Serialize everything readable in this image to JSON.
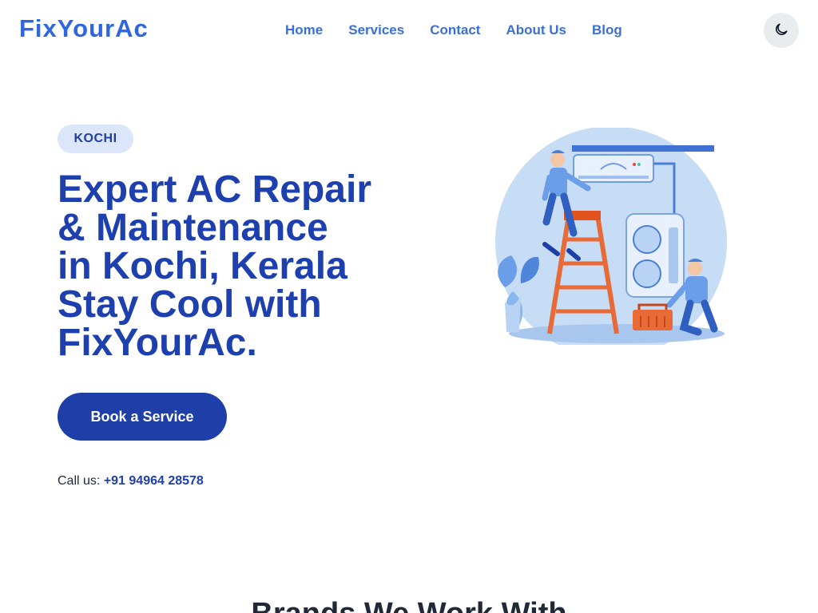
{
  "brand": {
    "name": "FixYourAc"
  },
  "nav": {
    "items": [
      {
        "label": "Home"
      },
      {
        "label": "Services"
      },
      {
        "label": "Contact"
      },
      {
        "label": "About Us"
      },
      {
        "label": "Blog"
      }
    ]
  },
  "theme_toggle": {
    "icon": "moon-icon"
  },
  "hero": {
    "badge": "KOCHI",
    "title_lines": [
      "Expert AC Repair",
      "& Maintenance",
      "in Kochi, Kerala",
      "Stay Cool with",
      "FixYourAc."
    ],
    "cta_label": "Book a Service",
    "call_prefix": "Call us:",
    "phone": "+91 94964 28578"
  },
  "brands": {
    "title": "Brands We Work With"
  },
  "colors": {
    "primary": "#1e40af",
    "accent": "#2f66e0",
    "badge_bg": "#dbe6fb",
    "button_bg": "#1e3fa8"
  }
}
